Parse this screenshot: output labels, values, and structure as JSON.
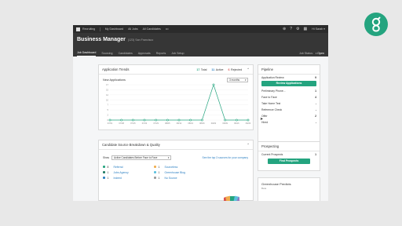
{
  "colors": {
    "brand": "#24a47f",
    "topbar": "#2b2b2b",
    "header": "#363636",
    "link": "#2b7fc2"
  },
  "topbar": {
    "items": [
      "Recruiting",
      "My Dashboard",
      "All Jobs",
      "All Candidates",
      "•••"
    ],
    "user": "Hi Sarah ▾",
    "icons": [
      "add-icon",
      "help-icon",
      "settings-icon",
      "grid-icon"
    ]
  },
  "header": {
    "job_title": "Business Manager",
    "location": "(123) San Francisco",
    "tabs": [
      "Job Dashboard",
      "Sourcing",
      "Candidates",
      "Approvals",
      "Reports",
      "Job Setup"
    ],
    "status_label": "Job Status:",
    "status_value": "• Open"
  },
  "trends": {
    "title": "Application Trends",
    "stats": [
      {
        "num": "17",
        "label": "Total",
        "color": "#24a47f"
      },
      {
        "num": "11",
        "label": "Active",
        "color": "#2b7fc2"
      },
      {
        "num": "6",
        "label": "Rejected",
        "color": "#d9534f"
      }
    ],
    "subtitle": "New Applications",
    "range": "3 months"
  },
  "chart_data": {
    "type": "line",
    "categories": [
      "07/01",
      "07/08",
      "07/15",
      "07/22",
      "07/29",
      "08/05",
      "08/12",
      "08/19",
      "08/26",
      "09/02",
      "09/09",
      "09/16",
      "09/23"
    ],
    "series": [
      {
        "values": [
          0,
          0,
          0,
          0,
          0,
          0,
          0,
          0,
          0,
          17,
          0,
          0,
          0
        ]
      }
    ],
    "yticks": [
      "17",
      "15",
      "12",
      "10",
      "7",
      "5",
      "2",
      "0"
    ],
    "ylim": [
      0,
      17
    ],
    "grid": true,
    "color": "#24a47f"
  },
  "breakdown": {
    "title": "Candidate Source Breakdown & Quality",
    "show_label": "Show",
    "filter": "Active Candidates Before Face to Face",
    "tip": "See the top 3 sources for your company",
    "sources_left": [
      {
        "count": "8",
        "name": "Referral",
        "color": "#24a47f"
      },
      {
        "count": "1",
        "name": "Jobs Agency",
        "color": "#1d7a62"
      },
      {
        "count": "1",
        "name": "Indeed",
        "color": "#2b7fc2"
      }
    ],
    "sources_right": [
      {
        "count": "1",
        "name": "Sourceless",
        "color": "#f0ad4e"
      },
      {
        "count": "1",
        "name": "Greenhouse Blog",
        "color": "#5bc0de"
      },
      {
        "count": "1",
        "name": "No Source",
        "color": "#999999"
      }
    ]
  },
  "pipeline": {
    "title": "Pipeline",
    "rows_top": [
      {
        "label": "Application Review",
        "value": "9"
      }
    ],
    "review_button": "Review Applications",
    "rows": [
      {
        "label": "Preliminary Phone...",
        "value": "1"
      },
      {
        "label": "Face to Face",
        "value": "4"
      },
      {
        "label": "Take Home Test",
        "value": "-"
      },
      {
        "label": "Reference Check",
        "value": "-"
      },
      {
        "label": "Offer",
        "value": "2"
      },
      {
        "label": "Hired",
        "value": "-"
      }
    ]
  },
  "prospecting": {
    "title": "Prospecting",
    "row": {
      "label": "Current Prospects",
      "value": "1"
    },
    "button": "Find Prospects"
  },
  "predicts": {
    "title": "Greenhouse Predicts",
    "sub": "Beta"
  }
}
